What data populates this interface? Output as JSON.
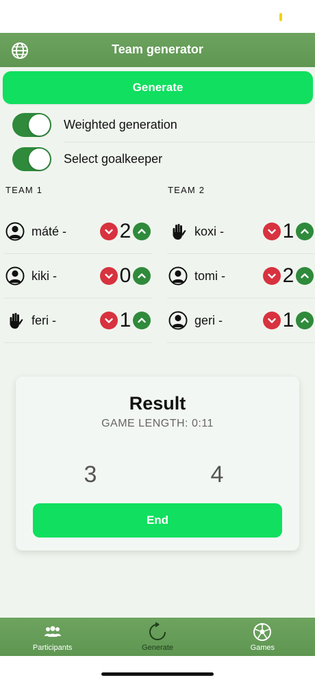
{
  "header": {
    "title": "Team generator",
    "globe_icon": "globe-icon"
  },
  "generate_button": {
    "label": "Generate"
  },
  "settings": {
    "weighted": {
      "label": "Weighted generation",
      "on": true
    },
    "goalkeeper": {
      "label": "Select goalkeeper",
      "on": true
    }
  },
  "teams": [
    {
      "heading": "TEAM 1",
      "players": [
        {
          "name": "máté -",
          "role": "person-icon",
          "weight": "2"
        },
        {
          "name": "kiki -",
          "role": "person-icon",
          "weight": "0"
        },
        {
          "name": "feri -",
          "role": "hand-icon",
          "weight": "1"
        }
      ]
    },
    {
      "heading": "TEAM 2",
      "players": [
        {
          "name": "koxi -",
          "role": "hand-icon",
          "weight": "1"
        },
        {
          "name": "tomi -",
          "role": "person-icon",
          "weight": "2"
        },
        {
          "name": "geri -",
          "role": "person-icon",
          "weight": "1"
        }
      ]
    }
  ],
  "result": {
    "title": "Result",
    "game_length": "GAME LENGTH: 0:11",
    "score_team1": "3",
    "score_team2": "4",
    "end_label": "End"
  },
  "tabs": [
    {
      "label": "Participants",
      "icon": "participants-icon",
      "active": false
    },
    {
      "label": "Generate",
      "icon": "refresh-icon",
      "active": true
    },
    {
      "label": "Games",
      "icon": "soccer-ball-icon",
      "active": false
    }
  ],
  "colors": {
    "header_green": "#66a05a",
    "primary_green": "#10df5f",
    "toggle_green": "#2f8a3b",
    "decrement_red": "#d8323f",
    "content_bg": "#eff5ee"
  }
}
